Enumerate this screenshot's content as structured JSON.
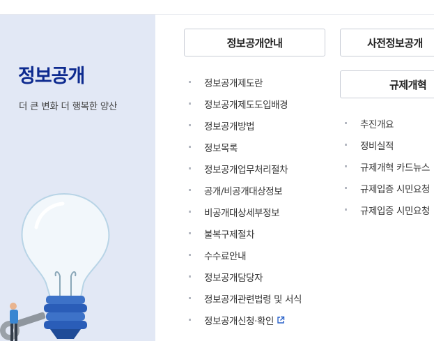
{
  "left": {
    "title": "정보공개",
    "subtitle": "더 큰 변화 더 행복한 양산"
  },
  "columns": [
    {
      "button_label": "정보공개안내",
      "items": [
        "정보공개제도란",
        "정보공개제도도입배경",
        "정보공개방법",
        "정보목록",
        "정보공개업무처리절차",
        "공개/비공개대상정보",
        "비공개대상세부정보",
        "불복구제절차",
        "수수료안내",
        "정보공개담당자",
        "정보공개관련법령 및 서식",
        "정보공개신청·확인"
      ]
    },
    {
      "button_label": "사전정보공개",
      "items": []
    },
    {
      "button_label": "규제개혁",
      "items": [
        "추진개요",
        "정비실적",
        "규제개혁 카드뉴스",
        "규제입증 시민요청",
        "규제입증 시민요청"
      ]
    }
  ],
  "icons": {
    "external_link": "external-link-icon",
    "bulb": "lightbulb-illustration"
  },
  "colors": {
    "panel_bg": "#e2e8f5",
    "title": "#0d2a8f",
    "accent_blue": "#2a62c9"
  }
}
